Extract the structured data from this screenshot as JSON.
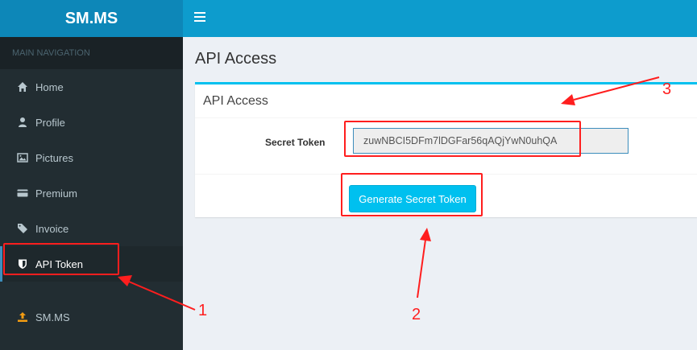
{
  "sidebar": {
    "logo": "SM.MS",
    "nav_header": "MAIN NAVIGATION",
    "items": [
      {
        "label": "Home",
        "icon": "home-icon"
      },
      {
        "label": "Profile",
        "icon": "user-icon"
      },
      {
        "label": "Pictures",
        "icon": "image-icon"
      },
      {
        "label": "Premium",
        "icon": "credit-card-icon"
      },
      {
        "label": "Invoice",
        "icon": "tag-icon"
      },
      {
        "label": "API Token",
        "icon": "shield-icon",
        "active": true
      }
    ],
    "footer_item": {
      "label": "SM.MS",
      "icon": "upload-icon"
    }
  },
  "topbar": {
    "menu_icon": "hamburger-icon"
  },
  "main": {
    "page_title": "API Access",
    "box_title": "API Access",
    "secret_token_label": "Secret Token",
    "secret_token_value": "zuwNBCI5DFm7lDGFar56qAQjYwN0uhQA",
    "generate_button": "Generate Secret Token"
  },
  "annotations": {
    "labels": [
      "1",
      "2",
      "3"
    ],
    "color": "#ff1e1e"
  },
  "colors": {
    "sidebar_bg": "#222d32",
    "logo_bg": "#0d87b8",
    "topbar_bg": "#0d9ccd",
    "accent": "#00c0ef",
    "content_bg": "#ecf0f5"
  }
}
